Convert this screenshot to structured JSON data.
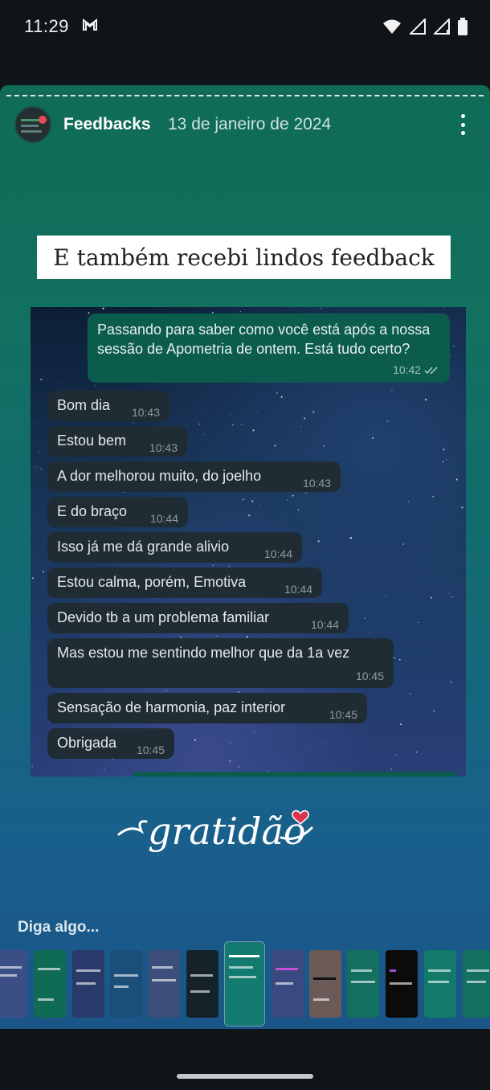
{
  "status": {
    "time": "11:29",
    "icons": [
      "gmail-icon",
      "wifi-icon",
      "signal-icon",
      "signal-icon",
      "battery-icon"
    ]
  },
  "story": {
    "title": "Feedbacks",
    "date": "13 de janeiro de 2024",
    "headline": "E também recebi lindos feedback",
    "outgoing": {
      "text": "Passando para saber como você está após a nossa sessão de Apometria de ontem. Está tudo certo?",
      "time": "10:42"
    },
    "messages": [
      {
        "text": "Bom dia",
        "time": "10:43"
      },
      {
        "text": "Estou bem",
        "time": "10:43"
      },
      {
        "text": "A dor melhorou muito, do joelho",
        "time": "10:43"
      },
      {
        "text": "E do braço",
        "time": "10:44"
      },
      {
        "text": "Isso já me dá grande alivio",
        "time": "10:44"
      },
      {
        "text": "Estou calma, porém,  Emotiva",
        "time": "10:44"
      },
      {
        "text": "Devido tb a um problema familiar",
        "time": "10:44"
      },
      {
        "text": "Mas estou me sentindo melhor que da 1a vez",
        "time": "10:45"
      },
      {
        "text": "Sensação de harmonia,  paz interior",
        "time": "10:45"
      },
      {
        "text": "Obrigada",
        "time": "10:45"
      }
    ],
    "signature": "gratidão",
    "reply_placeholder": "Diga algo..."
  },
  "colors": {
    "outgoing_bubble": "#0b5c4c",
    "incoming_bubble": "#1f2c33",
    "heart": "#d9344b"
  }
}
